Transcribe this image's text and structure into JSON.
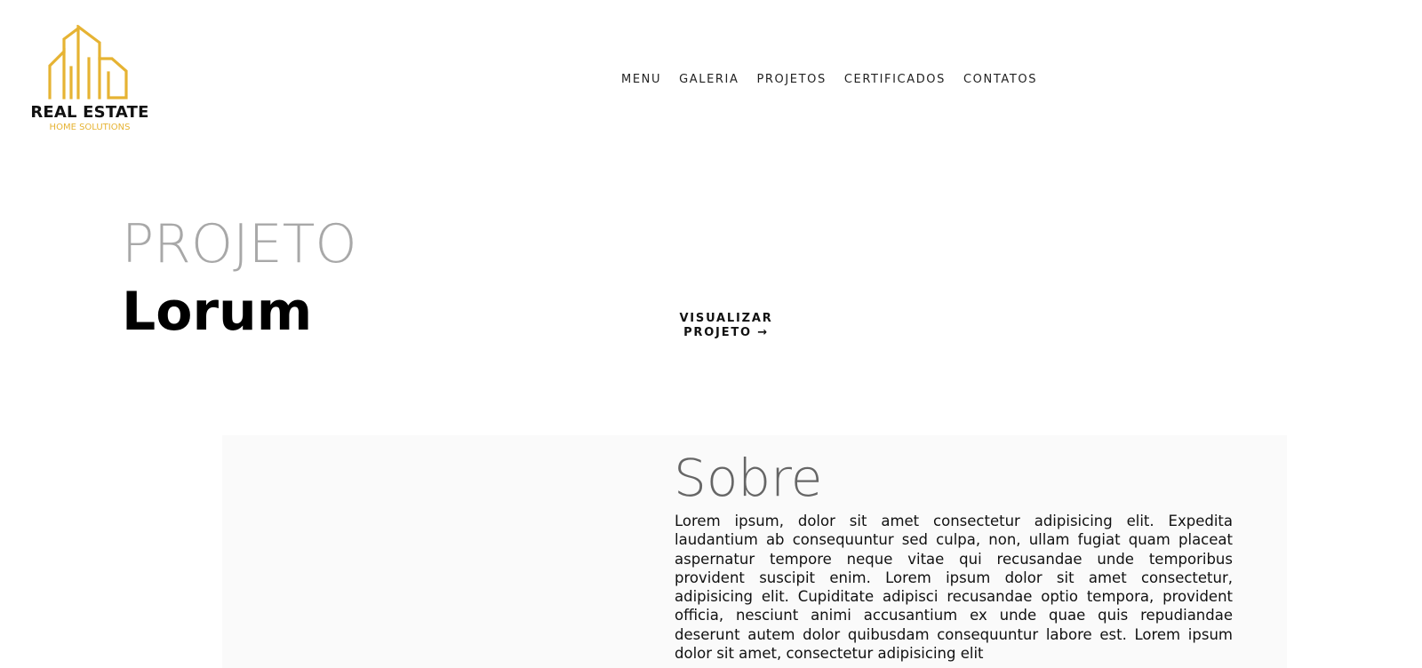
{
  "brand": {
    "name": "REAL ESTATE",
    "tagline": "HOME SOLUTIONS",
    "logo_icon": "buildings-outline-icon",
    "accent_color": "#e6b333"
  },
  "nav": {
    "items": [
      {
        "label": "MENU"
      },
      {
        "label": "GALERIA"
      },
      {
        "label": "PROJETOS"
      },
      {
        "label": "CERTIFICADOS"
      },
      {
        "label": "CONTATOS"
      }
    ]
  },
  "hero": {
    "kicker": "PROJETO",
    "title": "Lorum",
    "cta_line1": "VISUALIZAR",
    "cta_line2": "PROJETO →"
  },
  "about": {
    "heading": "Sobre",
    "body": "Lorem ipsum, dolor sit amet consectetur adipisicing elit. Expedita laudantium ab consequuntur sed culpa, non, ullam fugiat quam placeat aspernatur tempore neque vitae qui recusandae unde temporibus provident suscipit enim. Lorem ipsum dolor sit amet consectetur, adipisicing elit. Cupiditate adipisci recusandae optio tempora, provident officia, nesciunt animi accusantium ex unde quae quis repudiandae deserunt autem dolor quibusdam consequuntur labore est. Lorem ipsum dolor sit amet, consectetur adipisicing elit"
  }
}
